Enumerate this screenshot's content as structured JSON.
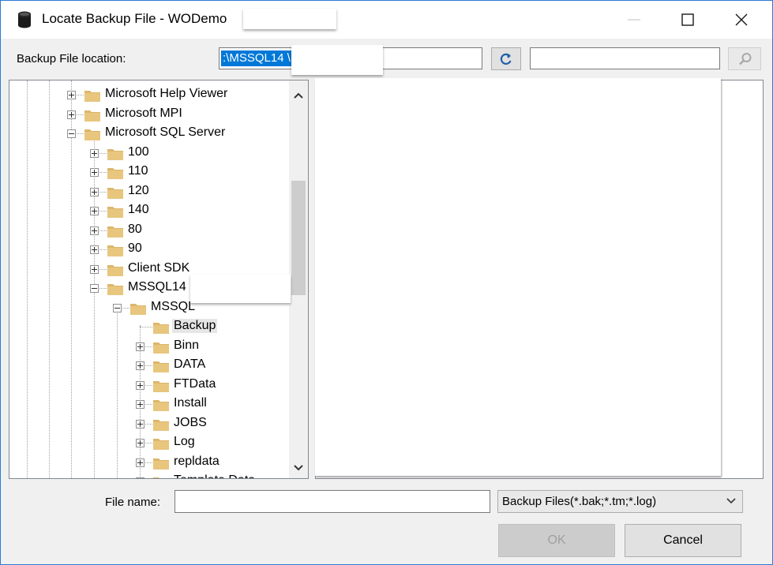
{
  "window": {
    "title": "Locate Backup File - WODemo"
  },
  "location": {
    "label": "Backup File location:",
    "value": ":\\MSSQL14          \\MSSQL\\Backup"
  },
  "tree": {
    "items": [
      {
        "label": "Microsoft Help Viewer",
        "level": 0,
        "state": "collapsed"
      },
      {
        "label": "Microsoft MPI",
        "level": 0,
        "state": "collapsed"
      },
      {
        "label": "Microsoft SQL Server",
        "level": 0,
        "state": "expanded"
      },
      {
        "label": "100",
        "level": 1,
        "state": "collapsed"
      },
      {
        "label": "110",
        "level": 1,
        "state": "collapsed"
      },
      {
        "label": "120",
        "level": 1,
        "state": "collapsed"
      },
      {
        "label": "140",
        "level": 1,
        "state": "collapsed"
      },
      {
        "label": "80",
        "level": 1,
        "state": "collapsed"
      },
      {
        "label": "90",
        "level": 1,
        "state": "collapsed"
      },
      {
        "label": "Client SDK",
        "level": 1,
        "state": "collapsed"
      },
      {
        "label": "MSSQL14",
        "level": 1,
        "state": "expanded"
      },
      {
        "label": "MSSQL",
        "level": 2,
        "state": "expanded"
      },
      {
        "label": "Backup",
        "level": 3,
        "state": "leaf",
        "selected": true
      },
      {
        "label": "Binn",
        "level": 3,
        "state": "collapsed"
      },
      {
        "label": "DATA",
        "level": 3,
        "state": "collapsed"
      },
      {
        "label": "FTData",
        "level": 3,
        "state": "collapsed"
      },
      {
        "label": "Install",
        "level": 3,
        "state": "collapsed"
      },
      {
        "label": "JOBS",
        "level": 3,
        "state": "collapsed"
      },
      {
        "label": "Log",
        "level": 3,
        "state": "collapsed"
      },
      {
        "label": "repldata",
        "level": 3,
        "state": "collapsed"
      },
      {
        "label": "Template Data",
        "level": 3,
        "state": "collapsed"
      }
    ]
  },
  "footer": {
    "file_name_label": "File name:",
    "file_name_value": "",
    "filter_selected": "Backup Files(*.bak;*.tm;*.log)",
    "ok_label": "OK",
    "cancel_label": "Cancel"
  },
  "colors": {
    "accent": "#0078d7",
    "window_border": "#2b79d6",
    "folder": "#dcb66a"
  },
  "icons": {
    "title": "database-icon",
    "refresh": "refresh-icon",
    "search": "search-icon",
    "folder": "folder-icon"
  }
}
